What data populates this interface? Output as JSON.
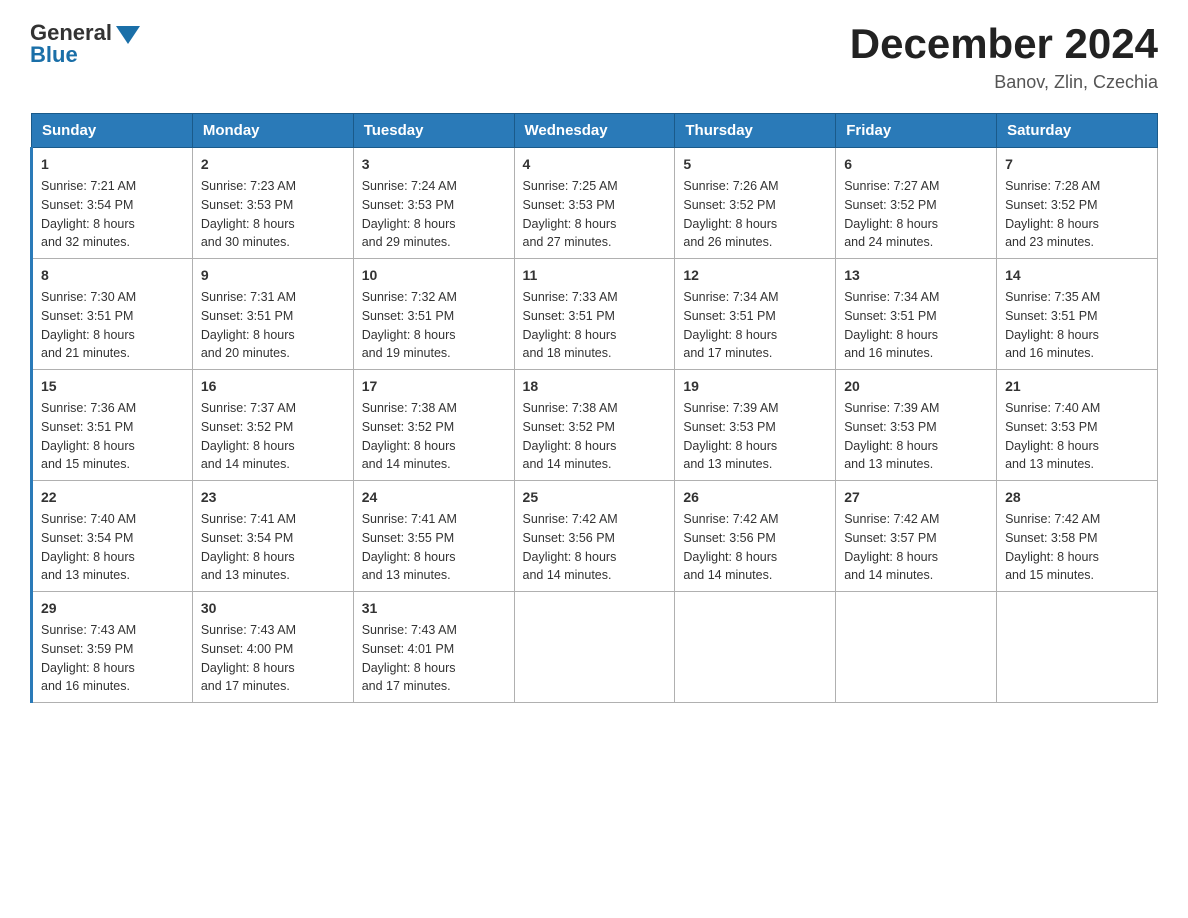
{
  "header": {
    "logo_general": "General",
    "logo_blue": "Blue",
    "month_title": "December 2024",
    "location": "Banov, Zlin, Czechia"
  },
  "weekdays": [
    "Sunday",
    "Monday",
    "Tuesday",
    "Wednesday",
    "Thursday",
    "Friday",
    "Saturday"
  ],
  "weeks": [
    [
      {
        "day": "1",
        "info": "Sunrise: 7:21 AM\nSunset: 3:54 PM\nDaylight: 8 hours\nand 32 minutes."
      },
      {
        "day": "2",
        "info": "Sunrise: 7:23 AM\nSunset: 3:53 PM\nDaylight: 8 hours\nand 30 minutes."
      },
      {
        "day": "3",
        "info": "Sunrise: 7:24 AM\nSunset: 3:53 PM\nDaylight: 8 hours\nand 29 minutes."
      },
      {
        "day": "4",
        "info": "Sunrise: 7:25 AM\nSunset: 3:53 PM\nDaylight: 8 hours\nand 27 minutes."
      },
      {
        "day": "5",
        "info": "Sunrise: 7:26 AM\nSunset: 3:52 PM\nDaylight: 8 hours\nand 26 minutes."
      },
      {
        "day": "6",
        "info": "Sunrise: 7:27 AM\nSunset: 3:52 PM\nDaylight: 8 hours\nand 24 minutes."
      },
      {
        "day": "7",
        "info": "Sunrise: 7:28 AM\nSunset: 3:52 PM\nDaylight: 8 hours\nand 23 minutes."
      }
    ],
    [
      {
        "day": "8",
        "info": "Sunrise: 7:30 AM\nSunset: 3:51 PM\nDaylight: 8 hours\nand 21 minutes."
      },
      {
        "day": "9",
        "info": "Sunrise: 7:31 AM\nSunset: 3:51 PM\nDaylight: 8 hours\nand 20 minutes."
      },
      {
        "day": "10",
        "info": "Sunrise: 7:32 AM\nSunset: 3:51 PM\nDaylight: 8 hours\nand 19 minutes."
      },
      {
        "day": "11",
        "info": "Sunrise: 7:33 AM\nSunset: 3:51 PM\nDaylight: 8 hours\nand 18 minutes."
      },
      {
        "day": "12",
        "info": "Sunrise: 7:34 AM\nSunset: 3:51 PM\nDaylight: 8 hours\nand 17 minutes."
      },
      {
        "day": "13",
        "info": "Sunrise: 7:34 AM\nSunset: 3:51 PM\nDaylight: 8 hours\nand 16 minutes."
      },
      {
        "day": "14",
        "info": "Sunrise: 7:35 AM\nSunset: 3:51 PM\nDaylight: 8 hours\nand 16 minutes."
      }
    ],
    [
      {
        "day": "15",
        "info": "Sunrise: 7:36 AM\nSunset: 3:51 PM\nDaylight: 8 hours\nand 15 minutes."
      },
      {
        "day": "16",
        "info": "Sunrise: 7:37 AM\nSunset: 3:52 PM\nDaylight: 8 hours\nand 14 minutes."
      },
      {
        "day": "17",
        "info": "Sunrise: 7:38 AM\nSunset: 3:52 PM\nDaylight: 8 hours\nand 14 minutes."
      },
      {
        "day": "18",
        "info": "Sunrise: 7:38 AM\nSunset: 3:52 PM\nDaylight: 8 hours\nand 14 minutes."
      },
      {
        "day": "19",
        "info": "Sunrise: 7:39 AM\nSunset: 3:53 PM\nDaylight: 8 hours\nand 13 minutes."
      },
      {
        "day": "20",
        "info": "Sunrise: 7:39 AM\nSunset: 3:53 PM\nDaylight: 8 hours\nand 13 minutes."
      },
      {
        "day": "21",
        "info": "Sunrise: 7:40 AM\nSunset: 3:53 PM\nDaylight: 8 hours\nand 13 minutes."
      }
    ],
    [
      {
        "day": "22",
        "info": "Sunrise: 7:40 AM\nSunset: 3:54 PM\nDaylight: 8 hours\nand 13 minutes."
      },
      {
        "day": "23",
        "info": "Sunrise: 7:41 AM\nSunset: 3:54 PM\nDaylight: 8 hours\nand 13 minutes."
      },
      {
        "day": "24",
        "info": "Sunrise: 7:41 AM\nSunset: 3:55 PM\nDaylight: 8 hours\nand 13 minutes."
      },
      {
        "day": "25",
        "info": "Sunrise: 7:42 AM\nSunset: 3:56 PM\nDaylight: 8 hours\nand 14 minutes."
      },
      {
        "day": "26",
        "info": "Sunrise: 7:42 AM\nSunset: 3:56 PM\nDaylight: 8 hours\nand 14 minutes."
      },
      {
        "day": "27",
        "info": "Sunrise: 7:42 AM\nSunset: 3:57 PM\nDaylight: 8 hours\nand 14 minutes."
      },
      {
        "day": "28",
        "info": "Sunrise: 7:42 AM\nSunset: 3:58 PM\nDaylight: 8 hours\nand 15 minutes."
      }
    ],
    [
      {
        "day": "29",
        "info": "Sunrise: 7:43 AM\nSunset: 3:59 PM\nDaylight: 8 hours\nand 16 minutes."
      },
      {
        "day": "30",
        "info": "Sunrise: 7:43 AM\nSunset: 4:00 PM\nDaylight: 8 hours\nand 17 minutes."
      },
      {
        "day": "31",
        "info": "Sunrise: 7:43 AM\nSunset: 4:01 PM\nDaylight: 8 hours\nand 17 minutes."
      },
      {
        "day": "",
        "info": ""
      },
      {
        "day": "",
        "info": ""
      },
      {
        "day": "",
        "info": ""
      },
      {
        "day": "",
        "info": ""
      }
    ]
  ]
}
